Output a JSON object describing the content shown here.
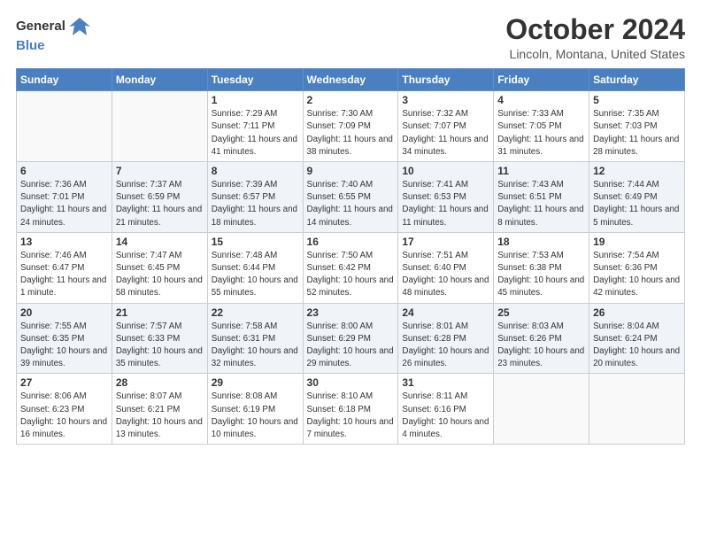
{
  "header": {
    "logo_general": "General",
    "logo_blue": "Blue",
    "month": "October 2024",
    "location": "Lincoln, Montana, United States"
  },
  "weekdays": [
    "Sunday",
    "Monday",
    "Tuesday",
    "Wednesday",
    "Thursday",
    "Friday",
    "Saturday"
  ],
  "weeks": [
    [
      {
        "day": "",
        "info": ""
      },
      {
        "day": "",
        "info": ""
      },
      {
        "day": "1",
        "info": "Sunrise: 7:29 AM\nSunset: 7:11 PM\nDaylight: 11 hours\nand 41 minutes."
      },
      {
        "day": "2",
        "info": "Sunrise: 7:30 AM\nSunset: 7:09 PM\nDaylight: 11 hours\nand 38 minutes."
      },
      {
        "day": "3",
        "info": "Sunrise: 7:32 AM\nSunset: 7:07 PM\nDaylight: 11 hours\nand 34 minutes."
      },
      {
        "day": "4",
        "info": "Sunrise: 7:33 AM\nSunset: 7:05 PM\nDaylight: 11 hours\nand 31 minutes."
      },
      {
        "day": "5",
        "info": "Sunrise: 7:35 AM\nSunset: 7:03 PM\nDaylight: 11 hours\nand 28 minutes."
      }
    ],
    [
      {
        "day": "6",
        "info": "Sunrise: 7:36 AM\nSunset: 7:01 PM\nDaylight: 11 hours\nand 24 minutes."
      },
      {
        "day": "7",
        "info": "Sunrise: 7:37 AM\nSunset: 6:59 PM\nDaylight: 11 hours\nand 21 minutes."
      },
      {
        "day": "8",
        "info": "Sunrise: 7:39 AM\nSunset: 6:57 PM\nDaylight: 11 hours\nand 18 minutes."
      },
      {
        "day": "9",
        "info": "Sunrise: 7:40 AM\nSunset: 6:55 PM\nDaylight: 11 hours\nand 14 minutes."
      },
      {
        "day": "10",
        "info": "Sunrise: 7:41 AM\nSunset: 6:53 PM\nDaylight: 11 hours\nand 11 minutes."
      },
      {
        "day": "11",
        "info": "Sunrise: 7:43 AM\nSunset: 6:51 PM\nDaylight: 11 hours\nand 8 minutes."
      },
      {
        "day": "12",
        "info": "Sunrise: 7:44 AM\nSunset: 6:49 PM\nDaylight: 11 hours\nand 5 minutes."
      }
    ],
    [
      {
        "day": "13",
        "info": "Sunrise: 7:46 AM\nSunset: 6:47 PM\nDaylight: 11 hours\nand 1 minute."
      },
      {
        "day": "14",
        "info": "Sunrise: 7:47 AM\nSunset: 6:45 PM\nDaylight: 10 hours\nand 58 minutes."
      },
      {
        "day": "15",
        "info": "Sunrise: 7:48 AM\nSunset: 6:44 PM\nDaylight: 10 hours\nand 55 minutes."
      },
      {
        "day": "16",
        "info": "Sunrise: 7:50 AM\nSunset: 6:42 PM\nDaylight: 10 hours\nand 52 minutes."
      },
      {
        "day": "17",
        "info": "Sunrise: 7:51 AM\nSunset: 6:40 PM\nDaylight: 10 hours\nand 48 minutes."
      },
      {
        "day": "18",
        "info": "Sunrise: 7:53 AM\nSunset: 6:38 PM\nDaylight: 10 hours\nand 45 minutes."
      },
      {
        "day": "19",
        "info": "Sunrise: 7:54 AM\nSunset: 6:36 PM\nDaylight: 10 hours\nand 42 minutes."
      }
    ],
    [
      {
        "day": "20",
        "info": "Sunrise: 7:55 AM\nSunset: 6:35 PM\nDaylight: 10 hours\nand 39 minutes."
      },
      {
        "day": "21",
        "info": "Sunrise: 7:57 AM\nSunset: 6:33 PM\nDaylight: 10 hours\nand 35 minutes."
      },
      {
        "day": "22",
        "info": "Sunrise: 7:58 AM\nSunset: 6:31 PM\nDaylight: 10 hours\nand 32 minutes."
      },
      {
        "day": "23",
        "info": "Sunrise: 8:00 AM\nSunset: 6:29 PM\nDaylight: 10 hours\nand 29 minutes."
      },
      {
        "day": "24",
        "info": "Sunrise: 8:01 AM\nSunset: 6:28 PM\nDaylight: 10 hours\nand 26 minutes."
      },
      {
        "day": "25",
        "info": "Sunrise: 8:03 AM\nSunset: 6:26 PM\nDaylight: 10 hours\nand 23 minutes."
      },
      {
        "day": "26",
        "info": "Sunrise: 8:04 AM\nSunset: 6:24 PM\nDaylight: 10 hours\nand 20 minutes."
      }
    ],
    [
      {
        "day": "27",
        "info": "Sunrise: 8:06 AM\nSunset: 6:23 PM\nDaylight: 10 hours\nand 16 minutes."
      },
      {
        "day": "28",
        "info": "Sunrise: 8:07 AM\nSunset: 6:21 PM\nDaylight: 10 hours\nand 13 minutes."
      },
      {
        "day": "29",
        "info": "Sunrise: 8:08 AM\nSunset: 6:19 PM\nDaylight: 10 hours\nand 10 minutes."
      },
      {
        "day": "30",
        "info": "Sunrise: 8:10 AM\nSunset: 6:18 PM\nDaylight: 10 hours\nand 7 minutes."
      },
      {
        "day": "31",
        "info": "Sunrise: 8:11 AM\nSunset: 6:16 PM\nDaylight: 10 hours\nand 4 minutes."
      },
      {
        "day": "",
        "info": ""
      },
      {
        "day": "",
        "info": ""
      }
    ]
  ]
}
